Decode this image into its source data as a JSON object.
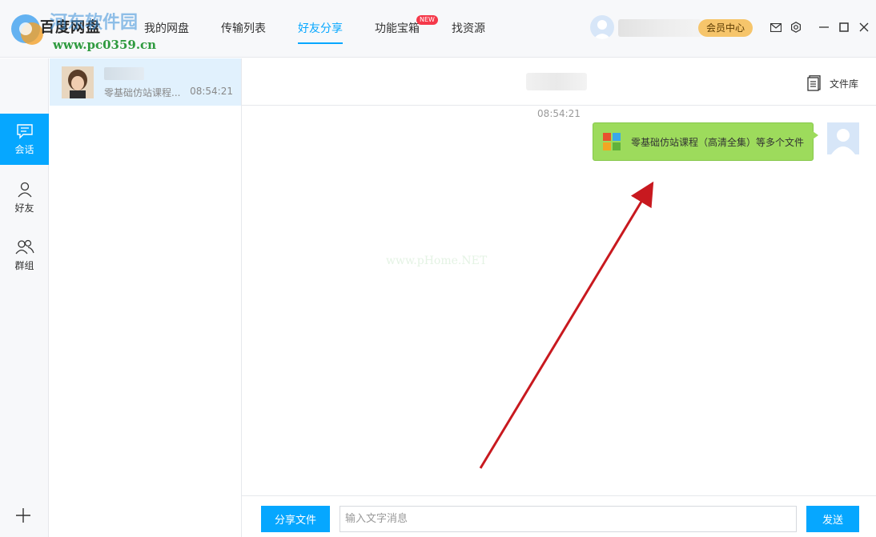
{
  "app": {
    "name": "百度网盘",
    "watermark_text": "河东软件园",
    "watermark_url": "www.pc0359.cn"
  },
  "nav": {
    "items": [
      {
        "label": "我的网盘"
      },
      {
        "label": "传输列表"
      },
      {
        "label": "好友分享",
        "active": true
      },
      {
        "label": "功能宝箱",
        "badge": "NEW"
      },
      {
        "label": "找资源"
      }
    ]
  },
  "titlebar": {
    "vip_label": "会员中心",
    "icons": [
      "mail-icon",
      "settings-icon",
      "minimize-icon",
      "maximize-icon",
      "close-icon"
    ]
  },
  "rail": {
    "items": [
      {
        "label": "会话",
        "icon": "chat-icon",
        "active": true
      },
      {
        "label": "好友",
        "icon": "person-icon"
      },
      {
        "label": "群组",
        "icon": "group-icon"
      }
    ],
    "add_icon": "plus-icon"
  },
  "conversations": [
    {
      "preview": "零基础仿站课程...",
      "time": "08:54:21"
    }
  ],
  "chat": {
    "file_library_label": "文件库",
    "message_time": "08:54:21",
    "message_text": "零基础仿站课程（高清全集）等多个文件",
    "faint_watermark": "www.pHome.NET"
  },
  "footer": {
    "share_label": "分享文件",
    "input_placeholder": "输入文字消息",
    "send_label": "发送"
  },
  "colors": {
    "accent": "#06a7ff",
    "bubble": "#9ddb5c",
    "vip": "#f6c56b",
    "badge": "#f5394a",
    "arrow": "#c8191f"
  }
}
